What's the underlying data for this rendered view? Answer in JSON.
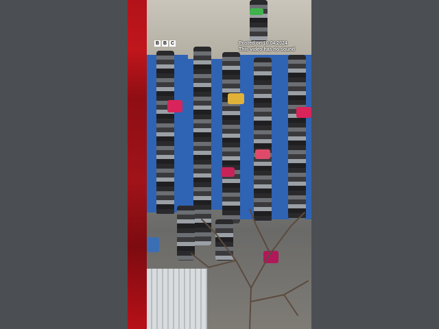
{
  "video": {
    "brand": {
      "letters": [
        "B",
        "B",
        "C"
      ]
    },
    "posted_text": "Posted on 10.04.2024",
    "sound_notice": "This video has no sound"
  },
  "colors": {
    "side_background": "#4b4e53",
    "brand_red": "#b3121a",
    "prayer_mat": "#2f63b4",
    "logo_white": "#ffffff"
  },
  "icons": {
    "brand_logo": "bbc-logo-icon"
  }
}
